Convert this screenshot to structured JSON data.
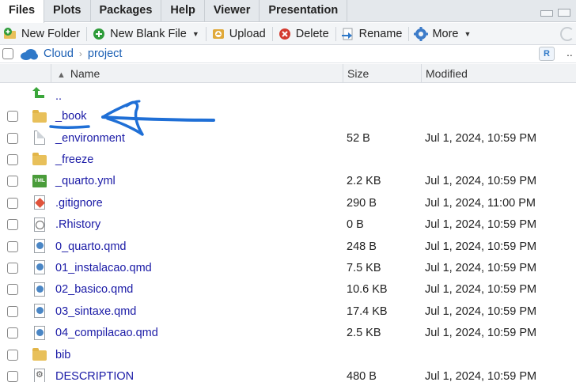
{
  "tabs": [
    {
      "label": "Files",
      "active": true
    },
    {
      "label": "Plots"
    },
    {
      "label": "Packages"
    },
    {
      "label": "Help"
    },
    {
      "label": "Viewer"
    },
    {
      "label": "Presentation"
    }
  ],
  "toolbar": {
    "new_folder": "New Folder",
    "new_blank_file": "New Blank File",
    "upload": "Upload",
    "delete": "Delete",
    "rename": "Rename",
    "more": "More"
  },
  "path": {
    "root": "Cloud",
    "current": "project",
    "r_badge": "R",
    "overflow": ".."
  },
  "columns": {
    "name": "Name",
    "size": "Size",
    "modified": "Modified"
  },
  "parent_dir": "..",
  "files": [
    {
      "name": "_book",
      "size": "",
      "modified": "",
      "icon": "folder-icon"
    },
    {
      "name": "_environment",
      "size": "52 B",
      "modified": "Jul 1, 2024, 10:59 PM",
      "icon": "file-icon"
    },
    {
      "name": "_freeze",
      "size": "",
      "modified": "",
      "icon": "folder-icon"
    },
    {
      "name": "_quarto.yml",
      "size": "2.2 KB",
      "modified": "Jul 1, 2024, 10:59 PM",
      "icon": "yml-icon"
    },
    {
      "name": ".gitignore",
      "size": "290 B",
      "modified": "Jul 1, 2024, 11:00 PM",
      "icon": "git-icon"
    },
    {
      "name": ".Rhistory",
      "size": "0 B",
      "modified": "Jul 1, 2024, 10:59 PM",
      "icon": "history-icon"
    },
    {
      "name": "0_quarto.qmd",
      "size": "248 B",
      "modified": "Jul 1, 2024, 10:59 PM",
      "icon": "quarto-icon"
    },
    {
      "name": "01_instalacao.qmd",
      "size": "7.5 KB",
      "modified": "Jul 1, 2024, 10:59 PM",
      "icon": "quarto-icon"
    },
    {
      "name": "02_basico.qmd",
      "size": "10.6 KB",
      "modified": "Jul 1, 2024, 10:59 PM",
      "icon": "quarto-icon"
    },
    {
      "name": "03_sintaxe.qmd",
      "size": "17.4 KB",
      "modified": "Jul 1, 2024, 10:59 PM",
      "icon": "quarto-icon"
    },
    {
      "name": "04_compilacao.qmd",
      "size": "2.5 KB",
      "modified": "Jul 1, 2024, 10:59 PM",
      "icon": "quarto-icon"
    },
    {
      "name": "bib",
      "size": "",
      "modified": "",
      "icon": "folder-icon"
    },
    {
      "name": "DESCRIPTION",
      "size": "480 B",
      "modified": "Jul 1, 2024, 10:59 PM",
      "icon": "description-icon"
    }
  ],
  "colors": {
    "annotation": "#1f6fd6",
    "link": "#1a1aa6",
    "path_link": "#1a5fb4"
  }
}
